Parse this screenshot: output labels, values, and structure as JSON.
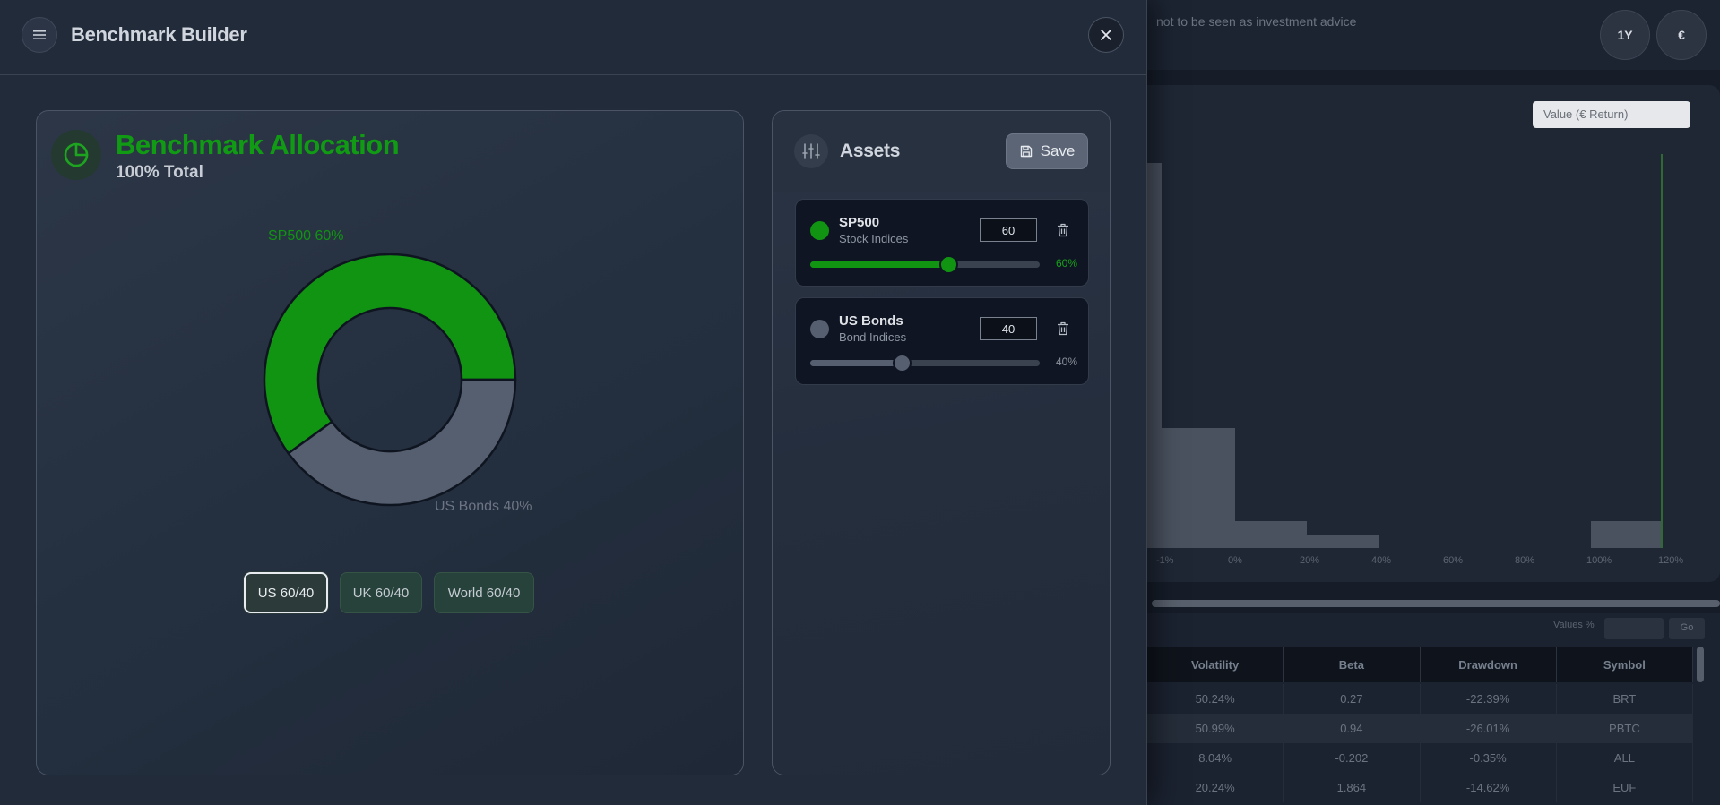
{
  "background": {
    "disclaimer": "not to be seen as investment advice",
    "period_button": "1Y",
    "currency_button": "€",
    "chart_dropdown": "Value (€ Return)",
    "table_controls": {
      "label": "Values %",
      "go_button": "Go"
    },
    "table_headers": [
      "Volatility",
      "Beta",
      "Drawdown",
      "Symbol"
    ],
    "table_rows": [
      [
        "50.24%",
        "0.27",
        "-22.39%",
        "BRT"
      ],
      [
        "50.99%",
        "0.94",
        "-26.01%",
        "PBTC"
      ],
      [
        "8.04%",
        "-0.202",
        "-0.35%",
        "ALL"
      ],
      [
        "20.24%",
        "1.864",
        "-14.62%",
        "EUF"
      ]
    ],
    "axis_ticks": [
      "-1%",
      "0%",
      "20%",
      "40%",
      "60%",
      "80%",
      "100%",
      "120%"
    ]
  },
  "drawer": {
    "title": "Benchmark Builder",
    "allocation": {
      "title": "Benchmark Allocation",
      "total_label": "100% Total",
      "segments": [
        {
          "label": "SP500 60%",
          "value": 60,
          "color": "#109412"
        },
        {
          "label": "US Bonds 40%",
          "value": 40,
          "color": "#555f6f"
        }
      ],
      "presets": [
        {
          "label": "US 60/40",
          "active": true
        },
        {
          "label": "UK 60/40",
          "active": false
        },
        {
          "label": "World 60/40",
          "active": false
        }
      ]
    },
    "assets": {
      "title": "Assets",
      "save_label": "Save",
      "items": [
        {
          "name": "SP500",
          "category": "Stock Indices",
          "value": "60",
          "percent_label": "60%",
          "fraction": 0.6,
          "color": "#109412",
          "pct_color": "#17a31a"
        },
        {
          "name": "US Bonds",
          "category": "Bond Indices",
          "value": "40",
          "percent_label": "40%",
          "fraction": 0.4,
          "color": "#555f6f",
          "pct_color": "#8a919c"
        }
      ]
    }
  },
  "icons": {
    "menu": "menu-icon",
    "close": "close-icon",
    "pie": "pie-chart-icon",
    "sliders": "sliders-icon",
    "save": "save-icon",
    "trash": "trash-icon"
  }
}
